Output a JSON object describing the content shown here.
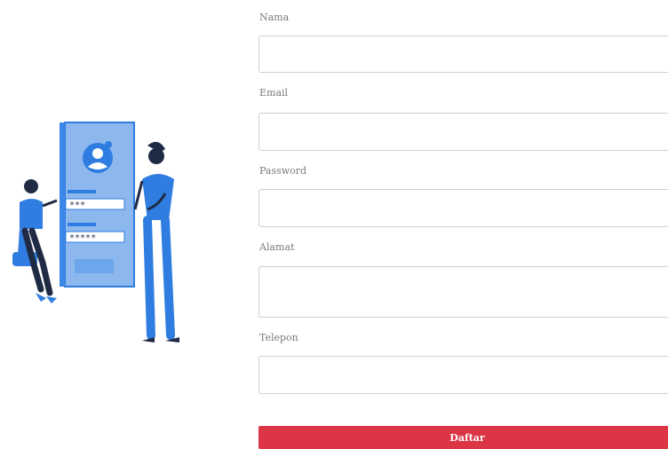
{
  "form": {
    "fields": [
      {
        "label": "Nama",
        "value": "",
        "placeholder": ""
      },
      {
        "label": "Email",
        "value": "",
        "placeholder": ""
      },
      {
        "label": "Password",
        "value": "",
        "placeholder": ""
      },
      {
        "label": "Alamat",
        "value": "",
        "placeholder": ""
      },
      {
        "label": "Telepon",
        "value": "",
        "placeholder": ""
      }
    ],
    "submit_label": "Daftar"
  },
  "illustration": {
    "icon": "login-illustration-icon",
    "masked_code_short": "***",
    "masked_code_long": "*****"
  },
  "colors": {
    "accent_blue": "#2f7de1",
    "dark_navy": "#1f2a44",
    "button_red": "#dc3545",
    "field_border": "#cfcfcf"
  }
}
